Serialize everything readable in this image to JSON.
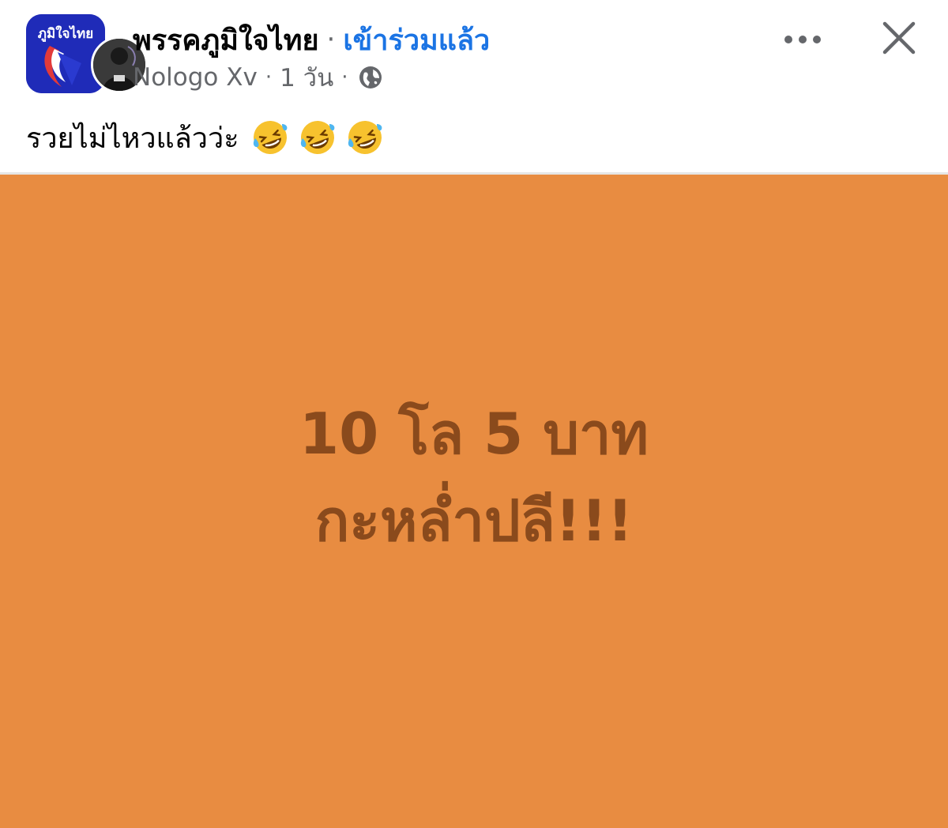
{
  "header": {
    "group_name": "พรรคภูมิใจไทย",
    "separator": "·",
    "join_status": "เข้าร่วมแล้ว",
    "author": "Nologo Xv",
    "meta_separator": "·",
    "time_ago": "1 วัน",
    "privacy_icon": "globe-icon",
    "more_icon": "more-horizontal-icon",
    "close_icon": "close-icon",
    "group_avatar_text": "ภูมิใจไทย"
  },
  "post": {
    "text": "รวยไม่ไหวแล้วว่ะ",
    "emojis": [
      "rolling-on-floor-laughing",
      "rolling-on-floor-laughing",
      "rolling-on-floor-laughing"
    ]
  },
  "image": {
    "background_color": "#e88c41",
    "text_color": "#8a4a1c",
    "line1": "10 โล 5 บาท",
    "line2": "กะหล่ำปลี!!!"
  },
  "colors": {
    "link_blue": "#1b74e4",
    "meta_gray": "#65676b",
    "group_avatar_blue": "#1f2bb8"
  }
}
